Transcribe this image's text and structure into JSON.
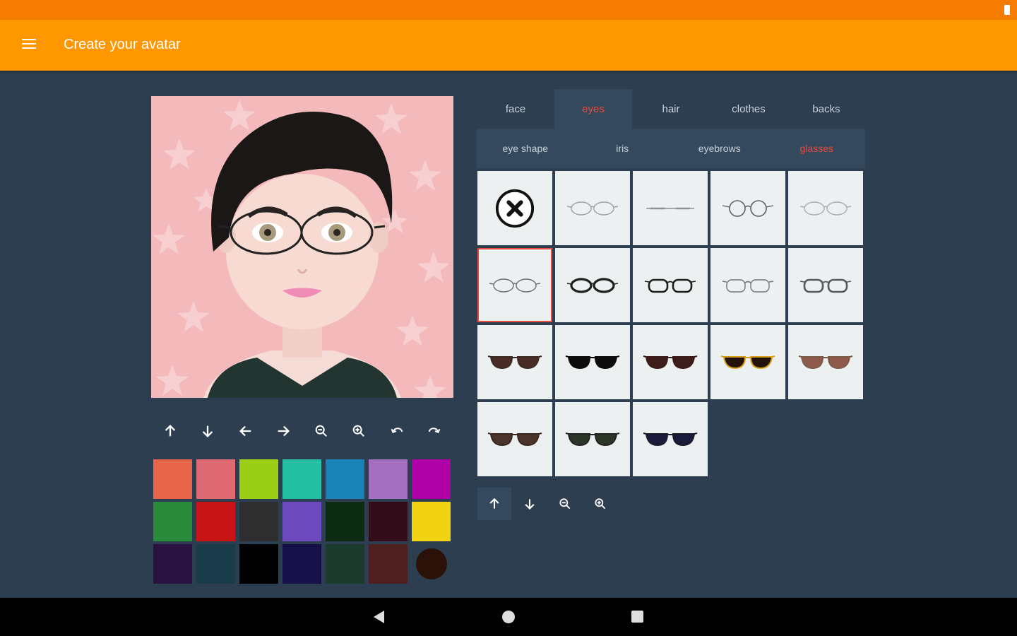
{
  "app_title": "Create your avatar",
  "colors": {
    "status_bar": "#f57c00",
    "app_bar": "#ff9800",
    "background": "#2c3e50",
    "panel": "#34495e",
    "accent": "#e74c3c"
  },
  "tabs": [
    {
      "label": "face",
      "active": false
    },
    {
      "label": "eyes",
      "active": true
    },
    {
      "label": "hair",
      "active": false
    },
    {
      "label": "clothes",
      "active": false
    },
    {
      "label": "backs",
      "active": false
    }
  ],
  "subtabs": [
    {
      "label": "eye shape",
      "active": false
    },
    {
      "label": "iris",
      "active": false
    },
    {
      "label": "eyebrows",
      "active": false
    },
    {
      "label": "glasses",
      "active": true
    }
  ],
  "preview_tools": [
    "arrow-up-icon",
    "arrow-down-icon",
    "arrow-left-icon",
    "arrow-right-icon",
    "zoom-out-icon",
    "zoom-in-icon",
    "rotate-left-icon",
    "rotate-right-icon"
  ],
  "palette": [
    "#e8644a",
    "#e06a74",
    "#9bcf15",
    "#25c0a4",
    "#1982b6",
    "#a46fbf",
    "#b000a8",
    "#2a8a3c",
    "#c81414",
    "#2f2f2f",
    "#6d4bbd",
    "#0d2b12",
    "#330c19",
    "#f2d312",
    "#2a1240",
    "#193b4a",
    "#000000",
    "#160f48",
    "#1c3b2d",
    "#4d1f1f",
    "#2b1208"
  ],
  "glasses_items": [
    {
      "kind": "none",
      "icon": "no-glasses-icon"
    },
    {
      "kind": "thin",
      "stroke": "#9aa0a4",
      "style": "oval"
    },
    {
      "kind": "thin",
      "stroke": "#8a8f93",
      "style": "line"
    },
    {
      "kind": "thin",
      "stroke": "#5a5f63",
      "style": "round"
    },
    {
      "kind": "thin",
      "stroke": "#a8adb1",
      "style": "oval"
    },
    {
      "kind": "thin",
      "stroke": "#6a6f73",
      "style": "oval",
      "selected": true
    },
    {
      "kind": "thin",
      "stroke": "#1e1e1e",
      "style": "thick"
    },
    {
      "kind": "thin",
      "stroke": "#1e1e1e",
      "style": "rect"
    },
    {
      "kind": "thin",
      "stroke": "#707478",
      "style": "browline"
    },
    {
      "kind": "thin",
      "stroke": "#55595c",
      "style": "rect"
    },
    {
      "kind": "sun",
      "lens": "#4a2b26",
      "frame": "#3a2a22"
    },
    {
      "kind": "sun",
      "lens": "#0c0c0c",
      "frame": "#0c0c0c"
    },
    {
      "kind": "sun",
      "lens": "#3d1c1a",
      "frame": "#3a1a18"
    },
    {
      "kind": "sun",
      "lens": "#241209",
      "frame": "#d4a017"
    },
    {
      "kind": "sun",
      "lens": "#8f5a4c",
      "frame": "#7b5a48"
    },
    {
      "kind": "sun",
      "lens": "#4b342c",
      "frame": "#3a2820"
    },
    {
      "kind": "sun",
      "lens": "#2c3626",
      "frame": "#222"
    },
    {
      "kind": "sun",
      "lens": "#1a1a3a",
      "frame": "#1a1a2a"
    }
  ],
  "glasses_tools": [
    "arrow-up-icon",
    "arrow-down-icon",
    "zoom-out-icon",
    "zoom-in-icon"
  ]
}
